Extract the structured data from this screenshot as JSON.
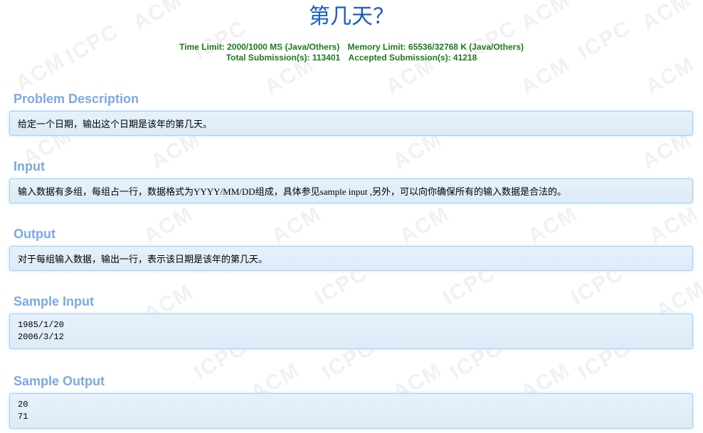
{
  "title": "第几天？",
  "limits": {
    "time_limit": "Time Limit: 2000/1000 MS (Java/Others)",
    "memory_limit": "Memory Limit: 65536/32768 K (Java/Others)",
    "total_submissions": "Total Submission(s): 113401",
    "accepted_submissions": "Accepted Submission(s): 41218"
  },
  "sections": {
    "problem_description": {
      "heading": "Problem Description",
      "text": "给定一个日期，输出这个日期是该年的第几天。"
    },
    "input": {
      "heading": "Input",
      "text": "输入数据有多组，每组占一行，数据格式为YYYY/MM/DD组成，具体参见sample input ,另外，可以向你确保所有的输入数据是合法的。"
    },
    "output": {
      "heading": "Output",
      "text": "对于每组输入数据，输出一行，表示该日期是该年的第几天。"
    },
    "sample_input": {
      "heading": "Sample Input",
      "lines": [
        "1985/1/20",
        "2006/3/12"
      ]
    },
    "sample_output": {
      "heading": "Sample Output",
      "lines": [
        "20",
        "71"
      ]
    }
  },
  "watermark": {
    "words": [
      "ACM",
      "ICPC"
    ]
  }
}
